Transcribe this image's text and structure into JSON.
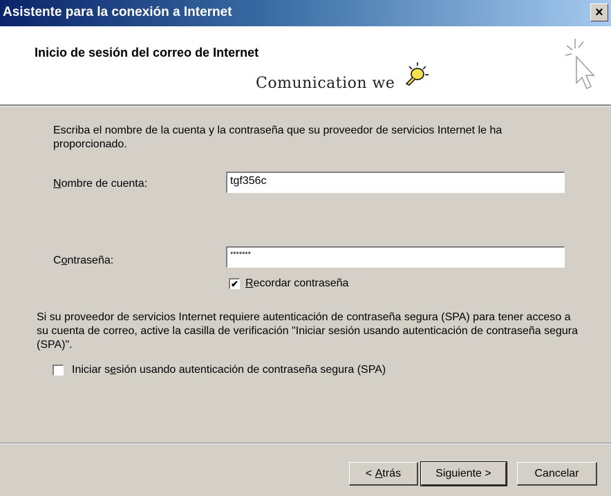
{
  "window": {
    "title": "Asistente para la conexión a Internet",
    "close_glyph": "×"
  },
  "header": {
    "title": "Inicio de sesión del correo de Internet",
    "logo_text": "Comunication we",
    "icons": [
      "lightbulb-icon",
      "wizard-cursor-icon"
    ]
  },
  "body": {
    "instructions": "Escriba el nombre de la cuenta y la contraseña que su proveedor de servicios Internet le ha proporcionado.",
    "account_label_access": "N",
    "account_label_rest": "ombre de cuenta:",
    "account_value": "tgf356c",
    "password_label_pre": "C",
    "password_label_access": "o",
    "password_label_rest": "ntraseña:",
    "password_value": "*******",
    "remember_checked_glyph": "✔",
    "remember_label_access": "R",
    "remember_label_rest": "ecordar contraseña",
    "spa_info": "Si su proveedor de servicios Internet requiere autenticación de contraseña segura (SPA) para tener acceso a su cuenta de correo, active la casilla de verificación \"Iniciar sesión usando autenticación de contraseña segura (SPA)\".",
    "spa_label_pre": "Iniciar s",
    "spa_label_access": "e",
    "spa_label_rest": "sión usando autenticación de contraseña segura (SPA)",
    "spa_checked": false
  },
  "footer": {
    "back_pre": "< ",
    "back_access": "A",
    "back_rest": "trás",
    "next_label": "Siguiente >",
    "cancel_label": "Cancelar"
  }
}
